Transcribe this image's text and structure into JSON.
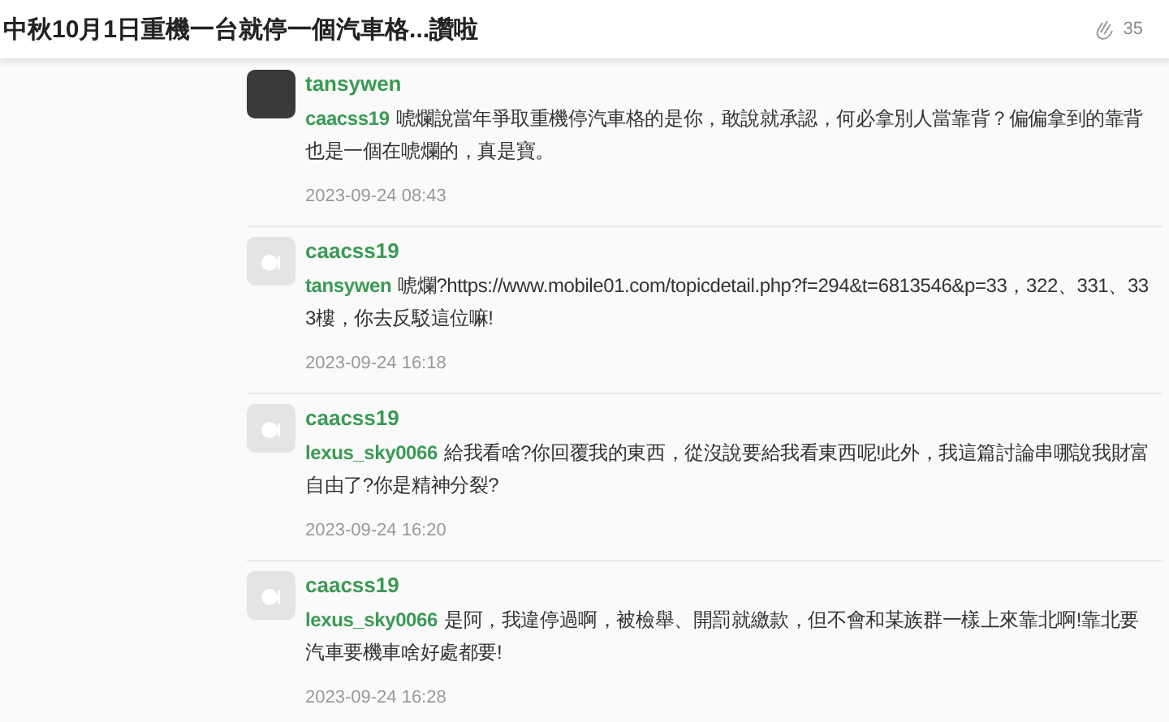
{
  "header": {
    "title": "中秋10月1日重機一台就停一個汽車格...讚啦",
    "clap_count": "35"
  },
  "comments": [
    {
      "avatar": {
        "kind": "photo"
      },
      "author": "tansywen",
      "mention": "caacss19",
      "text": "唬爛說當年爭取重機停汽車格的是你，敢說就承認，何必拿別人當靠背？偏偏拿到的靠背也是一個在唬爛的，真是寶。",
      "time": "2023-09-24 08:43"
    },
    {
      "avatar": {
        "kind": "default"
      },
      "author": "caacss19",
      "mention": "tansywen",
      "text": "唬爛?https://www.mobile01.com/topicdetail.php?f=294&t=6813546&p=33，322、331、333樓，你去反駁這位嘛!",
      "time": "2023-09-24 16:18"
    },
    {
      "avatar": {
        "kind": "default"
      },
      "author": "caacss19",
      "mention": "lexus_sky0066",
      "text": "給我看啥?你回覆我的東西，從沒說要給我看東西呢!此外，我這篇討論串哪說我財富自由了?你是精神分裂?",
      "time": "2023-09-24 16:20"
    },
    {
      "avatar": {
        "kind": "default"
      },
      "author": "caacss19",
      "mention": "lexus_sky0066",
      "text": "是阿，我違停過啊，被檢舉、開罰就繳款，但不會和某族群一樣上來靠北啊!靠北要汽車要機車啥好處都要!",
      "time": "2023-09-24 16:28"
    }
  ]
}
